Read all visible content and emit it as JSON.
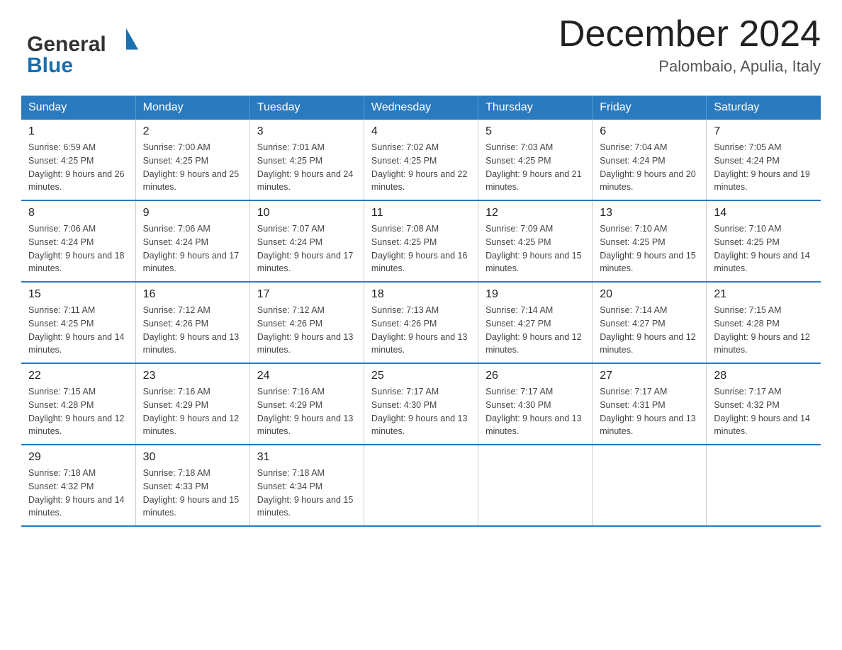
{
  "header": {
    "logo_general": "General",
    "logo_blue": "Blue",
    "month": "December 2024",
    "location": "Palombaio, Apulia, Italy"
  },
  "weekdays": [
    "Sunday",
    "Monday",
    "Tuesday",
    "Wednesday",
    "Thursday",
    "Friday",
    "Saturday"
  ],
  "weeks": [
    [
      {
        "day": "1",
        "sunrise": "Sunrise: 6:59 AM",
        "sunset": "Sunset: 4:25 PM",
        "daylight": "Daylight: 9 hours and 26 minutes."
      },
      {
        "day": "2",
        "sunrise": "Sunrise: 7:00 AM",
        "sunset": "Sunset: 4:25 PM",
        "daylight": "Daylight: 9 hours and 25 minutes."
      },
      {
        "day": "3",
        "sunrise": "Sunrise: 7:01 AM",
        "sunset": "Sunset: 4:25 PM",
        "daylight": "Daylight: 9 hours and 24 minutes."
      },
      {
        "day": "4",
        "sunrise": "Sunrise: 7:02 AM",
        "sunset": "Sunset: 4:25 PM",
        "daylight": "Daylight: 9 hours and 22 minutes."
      },
      {
        "day": "5",
        "sunrise": "Sunrise: 7:03 AM",
        "sunset": "Sunset: 4:25 PM",
        "daylight": "Daylight: 9 hours and 21 minutes."
      },
      {
        "day": "6",
        "sunrise": "Sunrise: 7:04 AM",
        "sunset": "Sunset: 4:24 PM",
        "daylight": "Daylight: 9 hours and 20 minutes."
      },
      {
        "day": "7",
        "sunrise": "Sunrise: 7:05 AM",
        "sunset": "Sunset: 4:24 PM",
        "daylight": "Daylight: 9 hours and 19 minutes."
      }
    ],
    [
      {
        "day": "8",
        "sunrise": "Sunrise: 7:06 AM",
        "sunset": "Sunset: 4:24 PM",
        "daylight": "Daylight: 9 hours and 18 minutes."
      },
      {
        "day": "9",
        "sunrise": "Sunrise: 7:06 AM",
        "sunset": "Sunset: 4:24 PM",
        "daylight": "Daylight: 9 hours and 17 minutes."
      },
      {
        "day": "10",
        "sunrise": "Sunrise: 7:07 AM",
        "sunset": "Sunset: 4:24 PM",
        "daylight": "Daylight: 9 hours and 17 minutes."
      },
      {
        "day": "11",
        "sunrise": "Sunrise: 7:08 AM",
        "sunset": "Sunset: 4:25 PM",
        "daylight": "Daylight: 9 hours and 16 minutes."
      },
      {
        "day": "12",
        "sunrise": "Sunrise: 7:09 AM",
        "sunset": "Sunset: 4:25 PM",
        "daylight": "Daylight: 9 hours and 15 minutes."
      },
      {
        "day": "13",
        "sunrise": "Sunrise: 7:10 AM",
        "sunset": "Sunset: 4:25 PM",
        "daylight": "Daylight: 9 hours and 15 minutes."
      },
      {
        "day": "14",
        "sunrise": "Sunrise: 7:10 AM",
        "sunset": "Sunset: 4:25 PM",
        "daylight": "Daylight: 9 hours and 14 minutes."
      }
    ],
    [
      {
        "day": "15",
        "sunrise": "Sunrise: 7:11 AM",
        "sunset": "Sunset: 4:25 PM",
        "daylight": "Daylight: 9 hours and 14 minutes."
      },
      {
        "day": "16",
        "sunrise": "Sunrise: 7:12 AM",
        "sunset": "Sunset: 4:26 PM",
        "daylight": "Daylight: 9 hours and 13 minutes."
      },
      {
        "day": "17",
        "sunrise": "Sunrise: 7:12 AM",
        "sunset": "Sunset: 4:26 PM",
        "daylight": "Daylight: 9 hours and 13 minutes."
      },
      {
        "day": "18",
        "sunrise": "Sunrise: 7:13 AM",
        "sunset": "Sunset: 4:26 PM",
        "daylight": "Daylight: 9 hours and 13 minutes."
      },
      {
        "day": "19",
        "sunrise": "Sunrise: 7:14 AM",
        "sunset": "Sunset: 4:27 PM",
        "daylight": "Daylight: 9 hours and 12 minutes."
      },
      {
        "day": "20",
        "sunrise": "Sunrise: 7:14 AM",
        "sunset": "Sunset: 4:27 PM",
        "daylight": "Daylight: 9 hours and 12 minutes."
      },
      {
        "day": "21",
        "sunrise": "Sunrise: 7:15 AM",
        "sunset": "Sunset: 4:28 PM",
        "daylight": "Daylight: 9 hours and 12 minutes."
      }
    ],
    [
      {
        "day": "22",
        "sunrise": "Sunrise: 7:15 AM",
        "sunset": "Sunset: 4:28 PM",
        "daylight": "Daylight: 9 hours and 12 minutes."
      },
      {
        "day": "23",
        "sunrise": "Sunrise: 7:16 AM",
        "sunset": "Sunset: 4:29 PM",
        "daylight": "Daylight: 9 hours and 12 minutes."
      },
      {
        "day": "24",
        "sunrise": "Sunrise: 7:16 AM",
        "sunset": "Sunset: 4:29 PM",
        "daylight": "Daylight: 9 hours and 13 minutes."
      },
      {
        "day": "25",
        "sunrise": "Sunrise: 7:17 AM",
        "sunset": "Sunset: 4:30 PM",
        "daylight": "Daylight: 9 hours and 13 minutes."
      },
      {
        "day": "26",
        "sunrise": "Sunrise: 7:17 AM",
        "sunset": "Sunset: 4:30 PM",
        "daylight": "Daylight: 9 hours and 13 minutes."
      },
      {
        "day": "27",
        "sunrise": "Sunrise: 7:17 AM",
        "sunset": "Sunset: 4:31 PM",
        "daylight": "Daylight: 9 hours and 13 minutes."
      },
      {
        "day": "28",
        "sunrise": "Sunrise: 7:17 AM",
        "sunset": "Sunset: 4:32 PM",
        "daylight": "Daylight: 9 hours and 14 minutes."
      }
    ],
    [
      {
        "day": "29",
        "sunrise": "Sunrise: 7:18 AM",
        "sunset": "Sunset: 4:32 PM",
        "daylight": "Daylight: 9 hours and 14 minutes."
      },
      {
        "day": "30",
        "sunrise": "Sunrise: 7:18 AM",
        "sunset": "Sunset: 4:33 PM",
        "daylight": "Daylight: 9 hours and 15 minutes."
      },
      {
        "day": "31",
        "sunrise": "Sunrise: 7:18 AM",
        "sunset": "Sunset: 4:34 PM",
        "daylight": "Daylight: 9 hours and 15 minutes."
      },
      null,
      null,
      null,
      null
    ]
  ]
}
